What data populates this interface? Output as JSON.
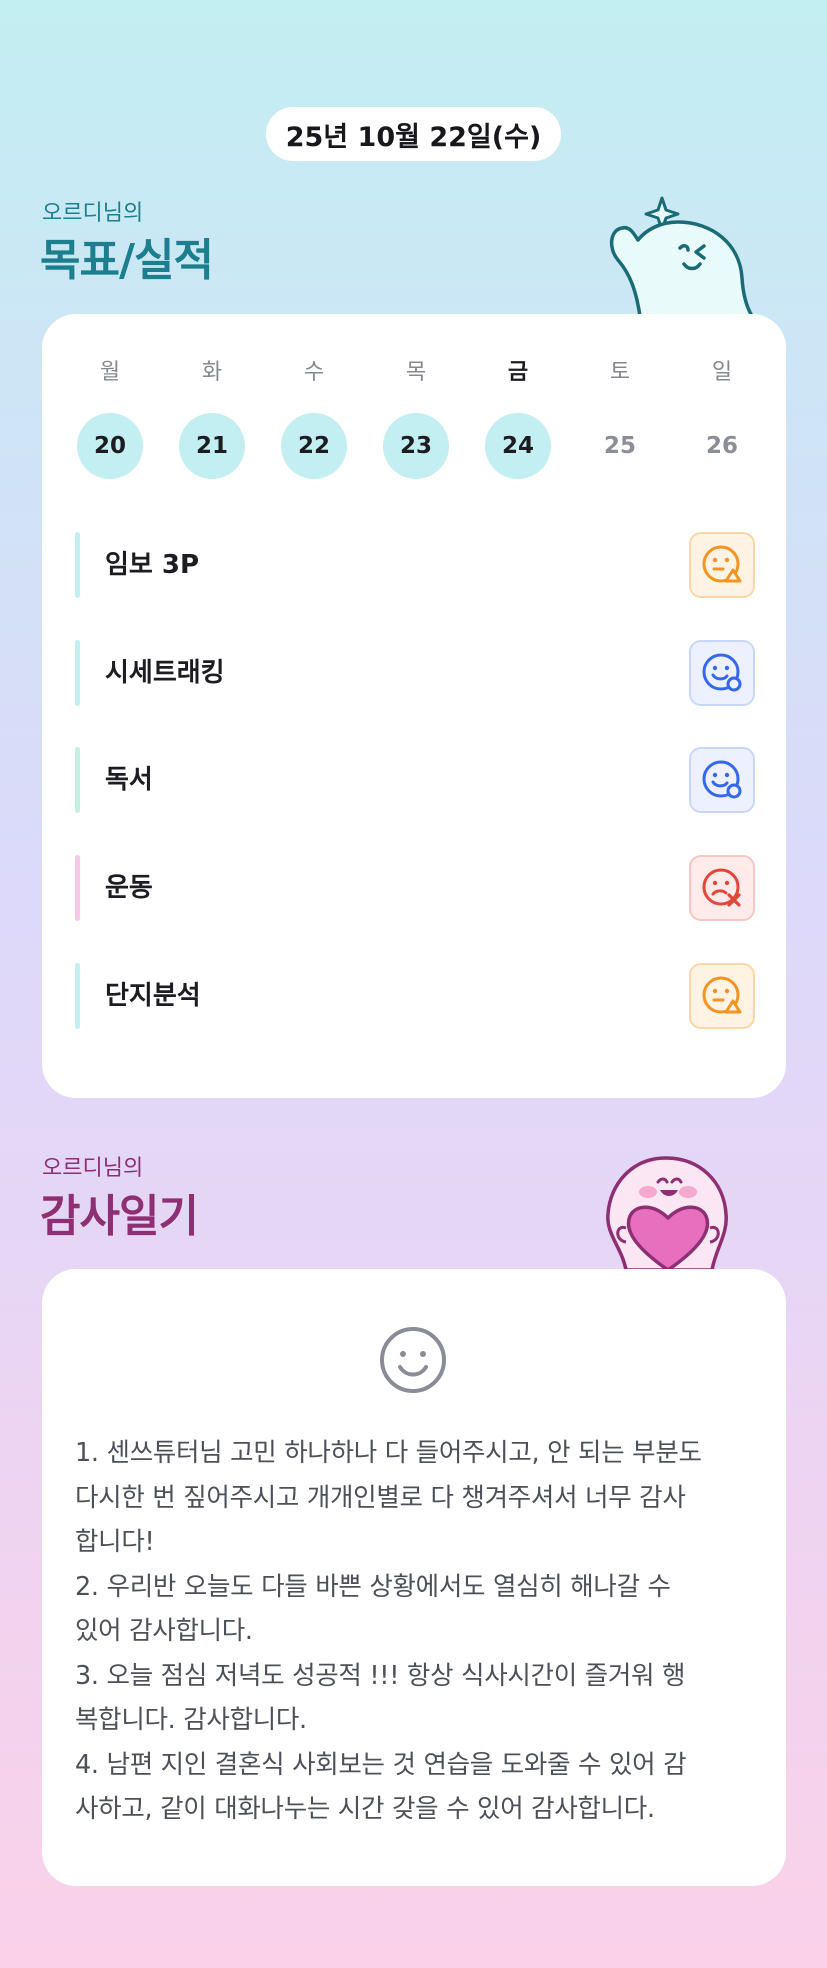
{
  "header": {
    "date": "25년 10월 22일(수)"
  },
  "goals_section": {
    "subtitle": "오르디님의",
    "title": "목표/실적"
  },
  "week": {
    "days": [
      {
        "name": "월",
        "num": "20",
        "marked": true,
        "today": false
      },
      {
        "name": "화",
        "num": "21",
        "marked": true,
        "today": false
      },
      {
        "name": "수",
        "num": "22",
        "marked": true,
        "today": false
      },
      {
        "name": "목",
        "num": "23",
        "marked": true,
        "today": false
      },
      {
        "name": "금",
        "num": "24",
        "marked": true,
        "today": true
      },
      {
        "name": "토",
        "num": "25",
        "marked": false,
        "today": false
      },
      {
        "name": "일",
        "num": "26",
        "marked": false,
        "today": false
      }
    ]
  },
  "goals": [
    {
      "label": "임보 3P",
      "bar_color": "#c3eef2",
      "status": "partial",
      "icon": "face-triangle-icon",
      "color": "#f29422"
    },
    {
      "label": "시세트래킹",
      "bar_color": "#c3eef2",
      "status": "done",
      "icon": "face-circle-icon",
      "color": "#3568e8"
    },
    {
      "label": "독서",
      "bar_color": "#c6efe3",
      "status": "done",
      "icon": "face-circle-icon",
      "color": "#3568e8"
    },
    {
      "label": "운동",
      "bar_color": "#f8c9e3",
      "status": "fail",
      "icon": "face-x-icon",
      "color": "#e2463b"
    },
    {
      "label": "단지분석",
      "bar_color": "#c3eef2",
      "status": "partial",
      "icon": "face-triangle-icon",
      "color": "#f29422"
    }
  ],
  "thanks_section": {
    "subtitle": "오르디님의",
    "title": "감사일기",
    "mood_icon": "smile-face-icon",
    "text": "1. 센쓰튜터님 고민 하나하나 다 들어주시고, 안 되는 부분도\n다시한 번 짚어주시고 개개인별로 다 챙겨주셔서 너무 감사\n합니다!\n2. 우리반 오늘도 다들 바쁜 상황에서도 열심히 해나갈 수\n있어 감사합니다.\n3. 오늘 점심 저녁도 성공적 !!! 항상 식사시간이 즐거워 행\n복합니다. 감사합니다.\n4. 남편 지인 결혼식 사회보는 것 연습을 도와줄 수 있어 감\n사하고, 같이 대화나누는 시간 갖을 수 있어 감사합니다."
  },
  "colors": {
    "accent_teal": "#1d7f8e",
    "accent_magenta": "#8d2f72",
    "day_marked": "#c3eef2"
  }
}
